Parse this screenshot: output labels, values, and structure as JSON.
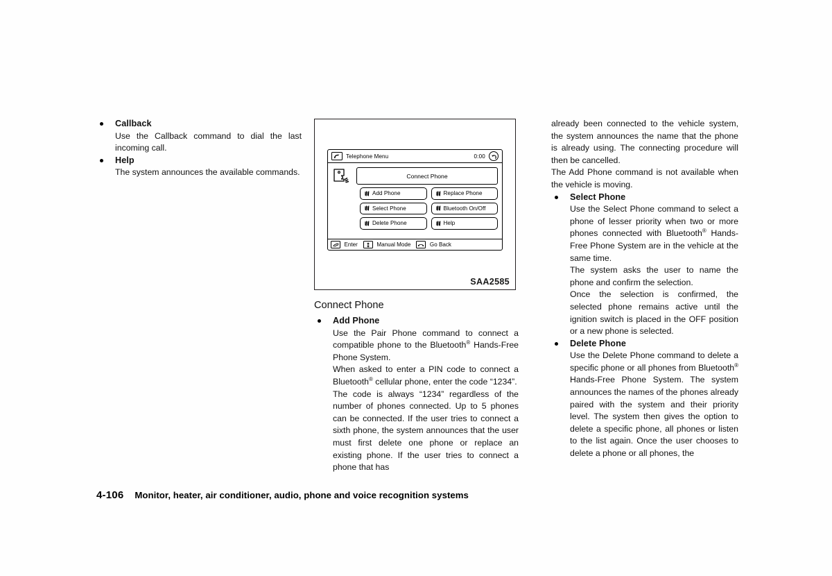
{
  "left_column": {
    "items": [
      {
        "title": "Callback",
        "paragraphs": [
          "Use the Callback command to dial the last incoming call."
        ]
      },
      {
        "title": "Help",
        "paragraphs": [
          "The system announces the available commands."
        ]
      }
    ]
  },
  "figure": {
    "code": "SAA2585",
    "screen": {
      "header": {
        "title": "Telephone Menu",
        "clock": "0:00",
        "phone_icon": "phone-icon",
        "back_icon": "back-arrow-icon"
      },
      "face_icon": "voice-speaking-face-icon",
      "connect_bar_label": "Connect Phone",
      "buttons": [
        "Add Phone",
        "Replace Phone",
        "Select Phone",
        "Bluetooth On/Off",
        "Delete Phone",
        "Help"
      ],
      "footer": [
        {
          "icon": "enter-key-icon",
          "label": "Enter"
        },
        {
          "icon": "updown-key-icon",
          "label": "Manual Mode"
        },
        {
          "icon": "hangup-key-icon",
          "label": "Go Back"
        }
      ]
    }
  },
  "mid_column": {
    "section_heading": "Connect Phone",
    "items": [
      {
        "title": "Add Phone",
        "paragraphs": [
          "Use the Pair Phone command to connect a compatible phone to the Bluetooth® Hands-Free Phone System.",
          "When asked to enter a PIN code to connect a Bluetooth® cellular phone, enter the code “1234”.",
          "The code is always “1234” regardless of the number of phones connected. Up to 5 phones can be connected. If the user tries to connect a sixth phone, the system announces that the user must first delete one phone or replace an existing phone. If the user tries to connect a phone that has"
        ]
      }
    ]
  },
  "right_column": {
    "continuation": [
      "already been connected to the vehicle system, the system announces the name that the phone is already using. The connecting procedure will then be cancelled.",
      "The Add Phone command is not available when the vehicle is moving."
    ],
    "items": [
      {
        "title": "Select Phone",
        "paragraphs": [
          "Use the Select Phone command to select a phone of lesser priority when two or more phones connected with Bluetooth® Hands-Free Phone System are in the vehicle at the same time.",
          "The system asks the user to name the phone and confirm the selection.",
          "Once the selection is confirmed, the selected phone remains active until the ignition switch is placed in the OFF position or a new phone is selected."
        ]
      },
      {
        "title": "Delete Phone",
        "paragraphs": [
          "Use the Delete Phone command to delete a specific phone or all phones from Bluetooth® Hands-Free Phone System. The system announces the names of the phones already paired with the system and their priority level. The system then gives the option to delete a specific phone, all phones or listen to the list again. Once the user chooses to delete a phone or all phones, the"
        ]
      }
    ]
  },
  "footer": {
    "page_number": "4-106",
    "title": "Monitor, heater, air conditioner, audio, phone and voice recognition systems"
  },
  "colors": {
    "ink": "#000000",
    "paper": "#ffffff"
  }
}
